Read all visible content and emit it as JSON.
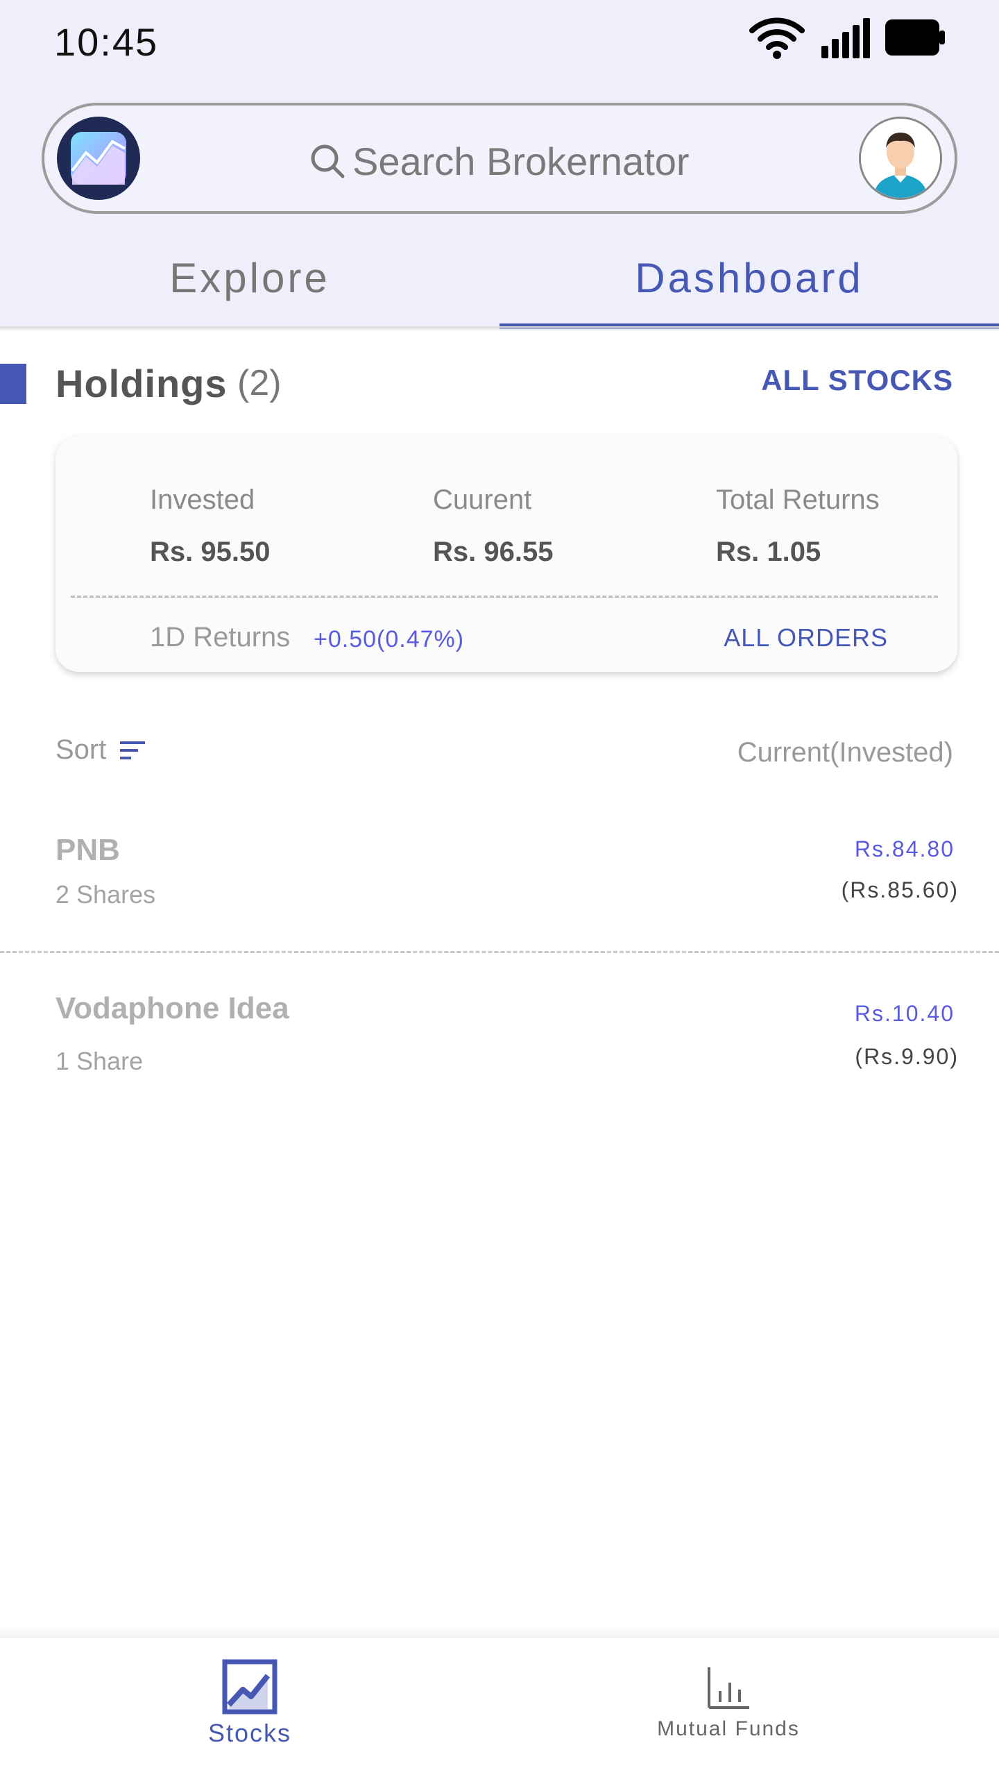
{
  "status_bar": {
    "time": "10:45",
    "icons": [
      "wifi-icon",
      "signal-icon",
      "battery-icon"
    ]
  },
  "search": {
    "placeholder": "Search Brokernator"
  },
  "tabs": [
    {
      "label": "Explore",
      "active": false
    },
    {
      "label": "Dashboard",
      "active": true
    }
  ],
  "holdings": {
    "title": "Holdings",
    "count": "(2)",
    "all_stocks_label": "ALL STOCKS",
    "summary": {
      "invested_label": "Invested",
      "invested_value": "Rs. 95.50",
      "current_label": "Cuurent",
      "current_value": "Rs. 96.55",
      "total_returns_label": "Total Returns",
      "total_returns_value": "Rs. 1.05",
      "one_day_label": "1D Returns",
      "one_day_value": "+0.50(0.47%)",
      "all_orders_label": "ALL ORDERS"
    }
  },
  "list_header": {
    "sort_label": "Sort",
    "right_label": "Current(Invested)"
  },
  "stocks": [
    {
      "name": "PNB",
      "quantity": "2 Shares",
      "current": "Rs.84.80",
      "invested": "(Rs.85.60)"
    },
    {
      "name": "Vodaphone Idea",
      "quantity": "1 Share",
      "current": "Rs.10.40",
      "invested": "(Rs.9.90)"
    }
  ],
  "bottom_nav": [
    {
      "label": "Stocks",
      "icon": "stocks-chart-icon",
      "active": true
    },
    {
      "label": "Mutual Funds",
      "icon": "bar-chart-icon",
      "active": false
    }
  ],
  "colors": {
    "accent": "#4658b4",
    "positive": "#5a5ae0",
    "header_bg": "#efeffb"
  }
}
